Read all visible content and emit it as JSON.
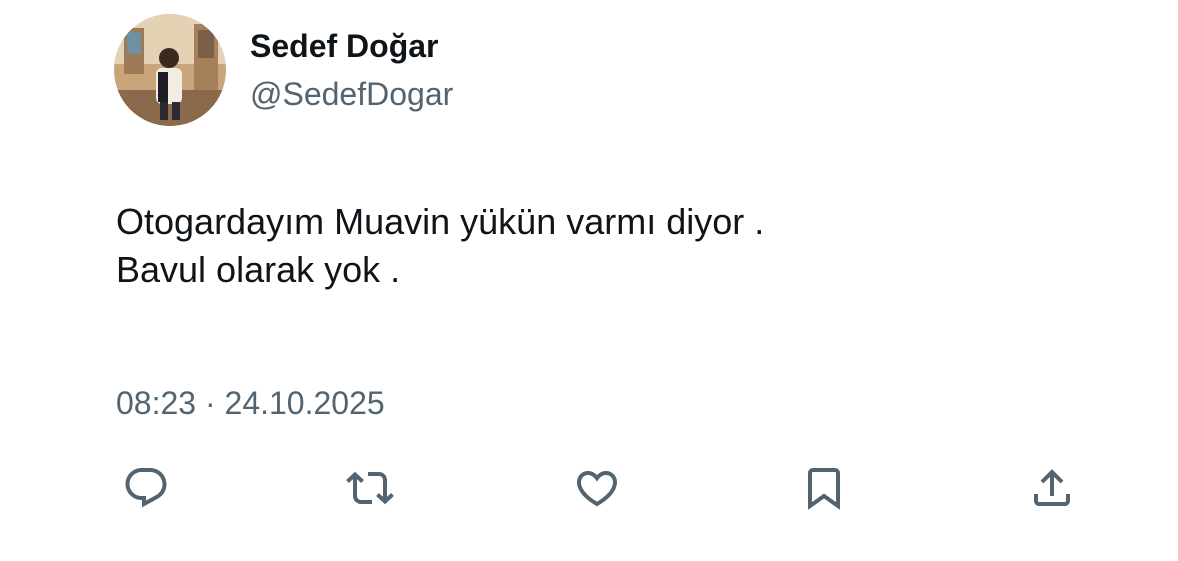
{
  "tweet": {
    "author": {
      "display_name": "Sedef Doğar",
      "handle": "@SedefDogar"
    },
    "text_lines": [
      "Otogardayım Muavin yükün varmı diyor .",
      "Bavul olarak yok ."
    ],
    "timestamp": "08:23 · 24.10.2025"
  },
  "actions": [
    "reply-icon",
    "retweet-icon",
    "like-icon",
    "bookmark-icon",
    "share-icon"
  ],
  "colors": {
    "text": "#0f1419",
    "secondary": "#536471",
    "icon": "#536471"
  }
}
